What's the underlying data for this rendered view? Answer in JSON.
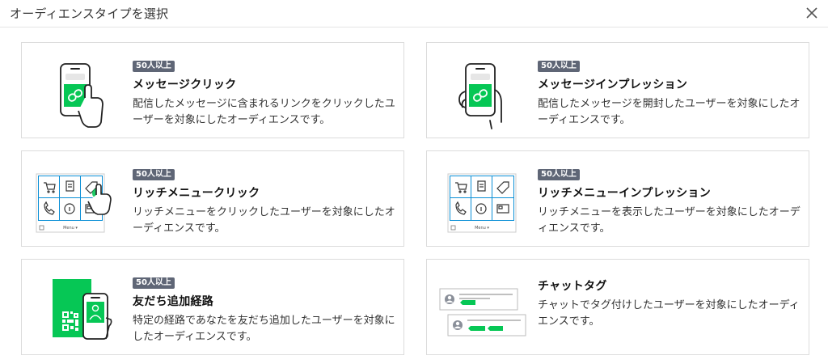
{
  "header": {
    "title": "オーディエンスタイプを選択",
    "close_icon": "close-icon"
  },
  "colors": {
    "accent_green": "#06c755",
    "badge_bg": "#5f6676",
    "border": "#dcdcdc"
  },
  "cards": [
    {
      "badge": "50人以上",
      "title": "メッセージクリック",
      "desc": "配信したメッセージに含まれるリンクをクリックしたユーザーを対象にしたオーディエンスです。",
      "icon": "phone-tap-icon"
    },
    {
      "badge": "50人以上",
      "title": "メッセージインプレッション",
      "desc": "配信したメッセージを開封したユーザーを対象にしたオーディエンスです。",
      "icon": "phone-hold-icon"
    },
    {
      "badge": "50人以上",
      "title": "リッチメニュークリック",
      "desc": "リッチメニューをクリックしたユーザーを対象にしたオーディエンスです。",
      "icon": "rich-menu-tap-icon"
    },
    {
      "badge": "50人以上",
      "title": "リッチメニューインプレッション",
      "desc": "リッチメニューを表示したユーザーを対象にしたオーディエンスです。",
      "icon": "rich-menu-icon"
    },
    {
      "badge": "50人以上",
      "title": "友だち追加経路",
      "desc": "特定の経路であなたを友だち追加したユーザーを対象にしたオーディエンスです。",
      "icon": "qr-add-friend-icon"
    },
    {
      "badge": "",
      "title": "チャットタグ",
      "desc": "チャットでタグ付けしたユーザーを対象にしたオーディエンスです。",
      "icon": "chat-tag-icon"
    }
  ],
  "rich_menu_label": "Menu ▾"
}
